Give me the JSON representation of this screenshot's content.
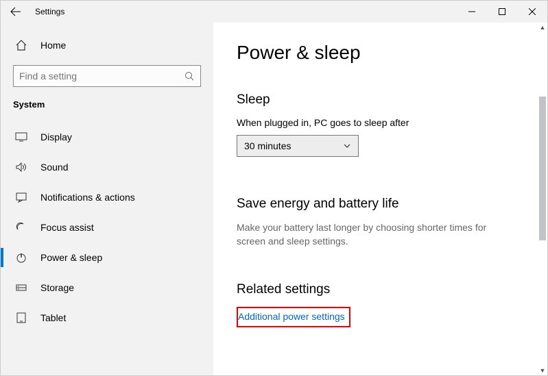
{
  "window": {
    "title": "Settings"
  },
  "sidebar": {
    "home_label": "Home",
    "search_placeholder": "Find a setting",
    "category": "System",
    "items": [
      {
        "icon": "display-icon",
        "label": "Display"
      },
      {
        "icon": "sound-icon",
        "label": "Sound"
      },
      {
        "icon": "notifications-icon",
        "label": "Notifications & actions"
      },
      {
        "icon": "focus-icon",
        "label": "Focus assist"
      },
      {
        "icon": "power-icon",
        "label": "Power & sleep"
      },
      {
        "icon": "storage-icon",
        "label": "Storage"
      },
      {
        "icon": "tablet-icon",
        "label": "Tablet"
      }
    ]
  },
  "main": {
    "title": "Power & sleep",
    "sleep_section": "Sleep",
    "sleep_field_label": "When plugged in, PC goes to sleep after",
    "sleep_value": "30 minutes",
    "energy_section": "Save energy and battery life",
    "energy_desc": "Make your battery last longer by choosing shorter times for screen and sleep settings.",
    "related_section": "Related settings",
    "related_link": "Additional power settings"
  }
}
